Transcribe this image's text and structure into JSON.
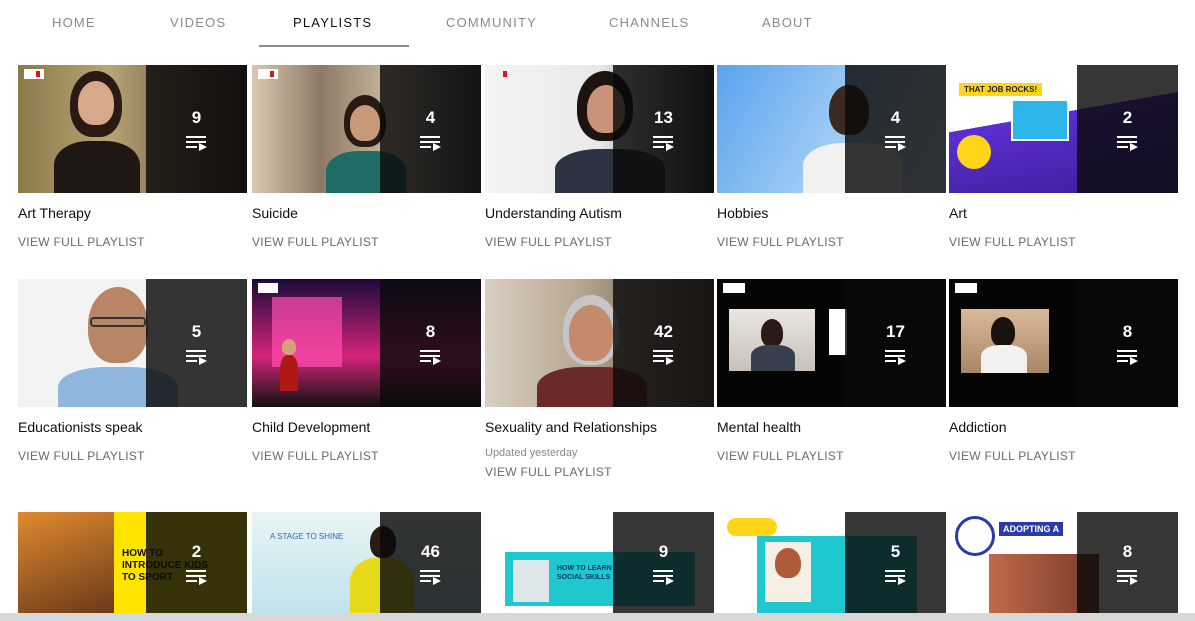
{
  "tabs": [
    {
      "label": "HOME",
      "active": false
    },
    {
      "label": "VIDEOS",
      "active": false
    },
    {
      "label": "PLAYLISTS",
      "active": true
    },
    {
      "label": "COMMUNITY",
      "active": false
    },
    {
      "label": "CHANNELS",
      "active": false
    },
    {
      "label": "ABOUT",
      "active": false
    }
  ],
  "playlists": [
    {
      "title": "Art Therapy",
      "count": "9",
      "link": "VIEW FULL PLAYLIST"
    },
    {
      "title": "Suicide",
      "count": "4",
      "link": "VIEW FULL PLAYLIST"
    },
    {
      "title": "Understanding Autism",
      "count": "13",
      "link": "VIEW FULL PLAYLIST"
    },
    {
      "title": "Hobbies",
      "count": "4",
      "link": "VIEW FULL PLAYLIST"
    },
    {
      "title": "Art",
      "count": "2",
      "link": "VIEW FULL PLAYLIST"
    },
    {
      "title": "Educationists speak",
      "count": "5",
      "link": "VIEW FULL PLAYLIST"
    },
    {
      "title": "Child Development",
      "count": "8",
      "link": "VIEW FULL PLAYLIST"
    },
    {
      "title": "Sexuality and Relationships",
      "count": "42",
      "updated": "Updated yesterday",
      "link": "VIEW FULL PLAYLIST"
    },
    {
      "title": "Mental health",
      "count": "17",
      "link": "VIEW FULL PLAYLIST"
    },
    {
      "title": "Addiction",
      "count": "8",
      "link": "VIEW FULL PLAYLIST"
    },
    {
      "title": "",
      "count": "2",
      "thumb_text": "HOW TO INTRODUCE KIDS TO SPORT"
    },
    {
      "title": "",
      "count": "46",
      "thumb_text": "A STAGE TO SHINE"
    },
    {
      "title": "",
      "count": "9",
      "thumb_text": "HOW TO LEARN SOCIAL SKILLS"
    },
    {
      "title": "",
      "count": "5"
    },
    {
      "title": "",
      "count": "8",
      "thumb_text": "ADOPTING A"
    }
  ],
  "art_thumb_text": "THAT JOB ROCKS!",
  "colors": {
    "active_tab": "#0f0f0f",
    "inactive_tab": "#8a8a8a",
    "overlay": "#0a0a0a"
  }
}
